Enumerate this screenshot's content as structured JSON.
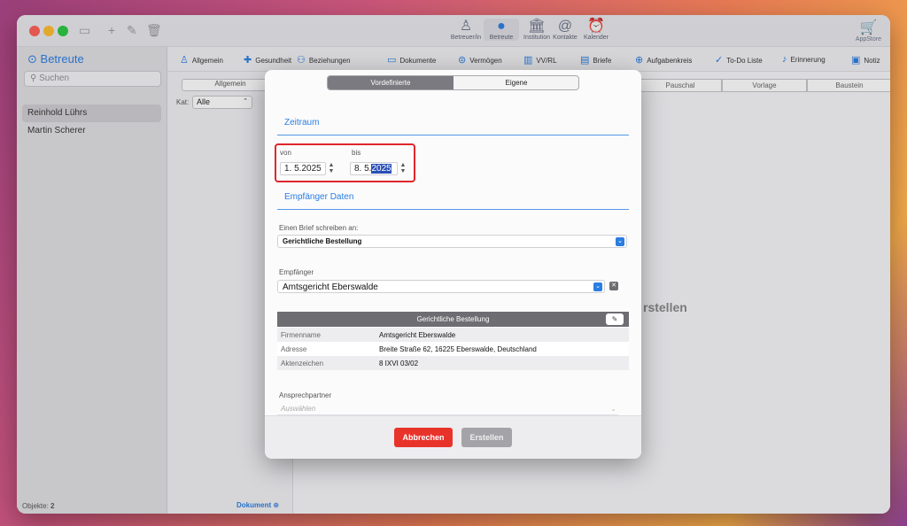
{
  "topnav": {
    "items": [
      {
        "label": "Betreuer/in",
        "icon": "person-outline-icon"
      },
      {
        "label": "Betreute",
        "icon": "person-icon"
      },
      {
        "label": "Institution",
        "icon": "institution-icon"
      },
      {
        "label": "Kontakte",
        "icon": "contacts-icon"
      },
      {
        "label": "Kalender",
        "icon": "alarm-clock-icon"
      }
    ],
    "appstore_label": "AppStore"
  },
  "sidebar": {
    "title": "Betreute",
    "search_placeholder": "Suchen",
    "items": [
      "Reinhold Lührs",
      "Martin Scherer"
    ],
    "footer_label": "Objekte:",
    "footer_count": "2"
  },
  "subtoolbar": {
    "items": [
      "Allgemein",
      "Gesundheit",
      "Beziehungen",
      "Dokumente",
      "Vermögen",
      "VV/RL",
      "Briefe",
      "Aufgabenkreis",
      "To-Do Liste",
      "Erinnerung",
      "Notiz"
    ]
  },
  "midpanel": {
    "tab": "Allgemein",
    "kat_label": "Kat:",
    "kat_value": "Alle",
    "footer": "Dokument"
  },
  "rightpane": {
    "segments": [
      "Pauschal",
      "Vorlage",
      "Baustein"
    ],
    "bg_text": "rstellen"
  },
  "modal": {
    "seg_vordef": "Vordefinierte",
    "seg_eigene": "Eigene",
    "zeitraum_title": "Zeitraum",
    "von_label": "von",
    "von_value": "1.  5.2025",
    "bis_label": "bis",
    "bis_value_prefix": "8.  5.",
    "bis_value_selected": "2025",
    "empfaenger_title": "Empfänger Daten",
    "brief_label": "Einen Brief schreiben an:",
    "brief_value": "Gerichtliche Bestellung",
    "empf_label": "Empfänger",
    "empf_value": "Amtsgericht Eberswalde",
    "info_title": "Gerichtliche Bestellung",
    "info_rows": [
      {
        "key": "Firmenname",
        "value": "Amtsgericht Eberswalde"
      },
      {
        "key": "Adresse",
        "value": "Breite Straße 62, 16225 Eberswalde, Deutschland"
      },
      {
        "key": "Aktenzeichen",
        "value": "8 IXVI 03/02"
      }
    ],
    "ansp_label": "Ansprechpartner",
    "ansp_placeholder": "Auswählen",
    "cancel_label": "Abbrechen",
    "create_label": "Erstellen"
  },
  "colors": {
    "accent": "#2a7de1",
    "danger": "#e8332b",
    "highlight": "#e0262b"
  }
}
